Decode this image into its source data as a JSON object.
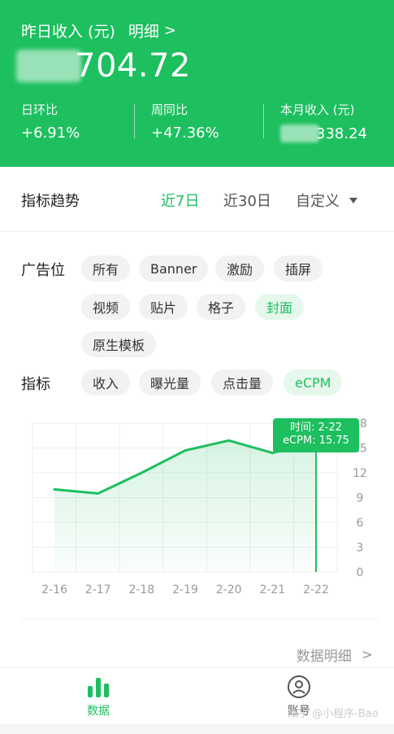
{
  "header": {
    "title": "昨日收入 (元)",
    "detail_label": "明细",
    "detail_chevron": ">",
    "yesterday_amount_visible": "704.72",
    "stats": [
      {
        "label": "日环比",
        "value": "+6.91%"
      },
      {
        "label": "周同比",
        "value": "+47.36%"
      },
      {
        "label": "本月收入 (元)",
        "value": "338.24"
      }
    ],
    "bg_color": "#1dbf5f"
  },
  "trend": {
    "title": "指标趋势",
    "options": [
      {
        "label": "近7日",
        "active": true
      },
      {
        "label": "近30日",
        "active": false
      },
      {
        "label": "自定义",
        "active": false
      }
    ]
  },
  "filters": {
    "ad_position_label": "广告位",
    "ad_positions": [
      {
        "label": "所有",
        "active": false
      },
      {
        "label": "Banner",
        "active": false
      },
      {
        "label": "激励",
        "active": false
      },
      {
        "label": "插屏",
        "active": false
      },
      {
        "label": "视频",
        "active": false
      },
      {
        "label": "贴片",
        "active": false
      },
      {
        "label": "格子",
        "active": false
      },
      {
        "label": "封面",
        "active": true
      },
      {
        "label": "原生模板",
        "active": false
      }
    ],
    "metric_label": "指标",
    "metrics": [
      {
        "label": "收入",
        "active": false
      },
      {
        "label": "曝光量",
        "active": false
      },
      {
        "label": "点击量",
        "active": false
      },
      {
        "label": "eCPM",
        "active": true
      }
    ]
  },
  "chart_data": {
    "type": "line",
    "categories": [
      "2-16",
      "2-17",
      "2-18",
      "2-19",
      "2-20",
      "2-21",
      "2-22"
    ],
    "series": [
      {
        "name": "eCPM",
        "values": [
          10.0,
          9.5,
          12.0,
          14.7,
          15.9,
          14.4,
          15.75
        ]
      }
    ],
    "y_ticks": [
      "0",
      "3",
      "6",
      "9",
      "12",
      "15",
      "18"
    ],
    "ylim": [
      0,
      18
    ],
    "grid": true,
    "line_color": "#1dbf5f",
    "tooltip": {
      "time_label": "时间: 2-22",
      "value_label": "eCPM: 15.75"
    }
  },
  "footer": {
    "data_detail_label": "数据明细",
    "chevron": ">"
  },
  "tabbar": {
    "tabs": [
      {
        "label": "数据",
        "icon": "bar-chart-icon",
        "active": true
      },
      {
        "label": "账号",
        "icon": "user-icon",
        "active": false
      }
    ],
    "watermark": "知乎 @小程序-Bao"
  }
}
